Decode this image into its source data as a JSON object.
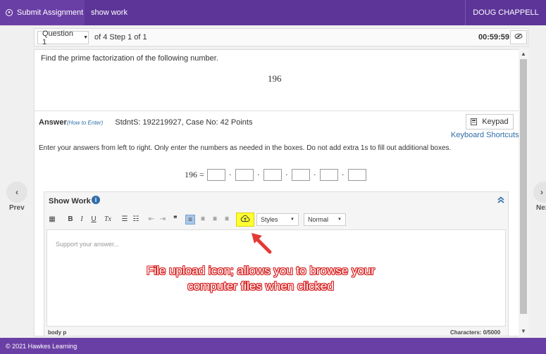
{
  "topbar": {
    "submit_label": "Submit Assignment",
    "show_work_label": "show work",
    "user_name": "DOUG CHAPPELL"
  },
  "question_bar": {
    "question_select": "Question 1",
    "step_text": "of 4 Step 1 of 1",
    "timer": "00:59:59"
  },
  "question": {
    "prompt": "Find the prime factorization of the following number.",
    "number": "196"
  },
  "answer": {
    "label": "Answer",
    "how_to": "(How to Enter)",
    "student_info": "StdntS: 192219927, Case No: 42 Points",
    "keypad_label": "Keypad",
    "keyboard_shortcuts": "Keyboard Shortcuts",
    "instructions": "Enter your answers from left to right. Only enter the numbers as needed in the boxes. Do not add extra 1s to fill out additional boxes.",
    "equation_lhs": "196 =",
    "box_count": 6
  },
  "show_work": {
    "title": "Show Work",
    "toolbar": {
      "styles_label": "Styles",
      "format_label": "Normal"
    },
    "placeholder": "Support your answer...",
    "element_path": "body  p",
    "char_count": "Characters: 0/5000"
  },
  "annotation": {
    "line1": "File upload icon; allows you to browse your",
    "line2": "computer files when clicked"
  },
  "nav": {
    "prev_label": "Prev",
    "next_label": "Next"
  },
  "footer": {
    "copyright": "© 2021 Hawkes Learning"
  },
  "colors": {
    "brand_purple": "#6a3fa5",
    "link_blue": "#2f6ea8",
    "highlight_yellow": "#ffff33",
    "annotation_red": "#d81e1e"
  }
}
